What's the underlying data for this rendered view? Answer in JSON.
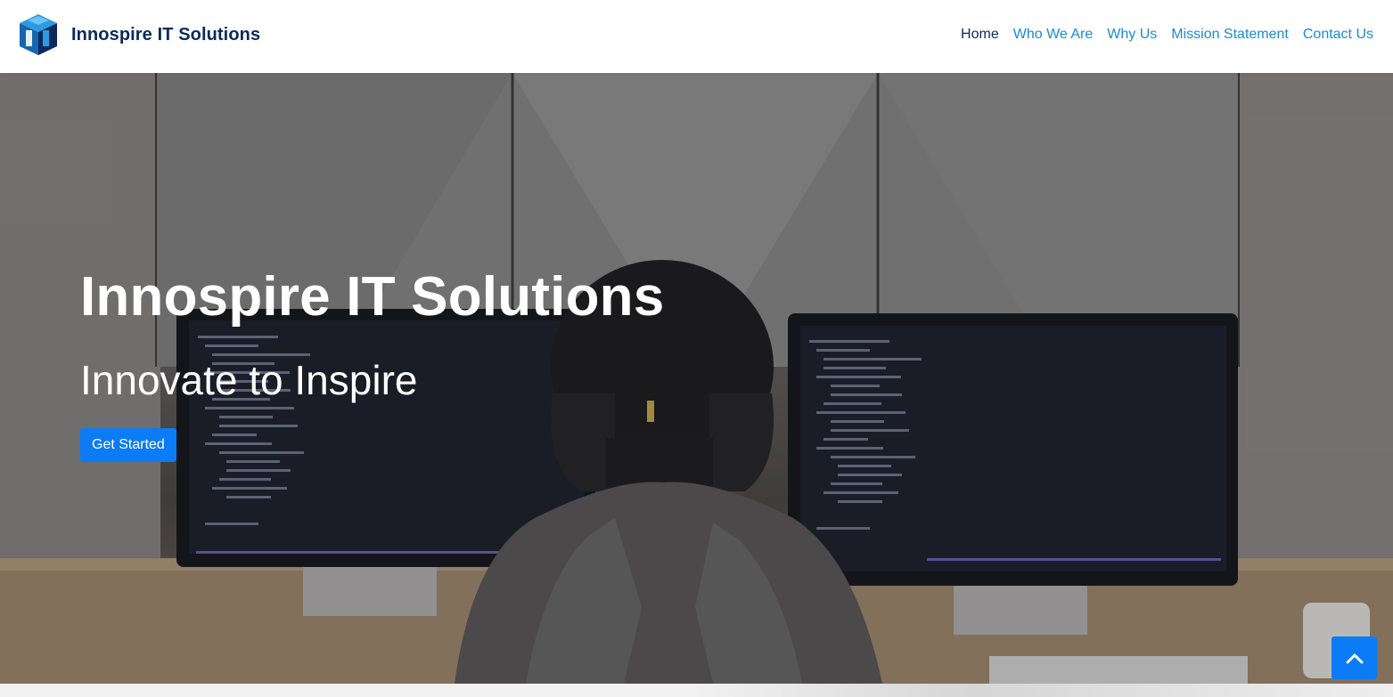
{
  "brand": {
    "name": "Innospire IT Solutions",
    "logo_icon": "cube-logo-icon"
  },
  "nav": {
    "items": [
      {
        "label": "Home",
        "active": true
      },
      {
        "label": "Who We Are",
        "active": false
      },
      {
        "label": "Why Us",
        "active": false
      },
      {
        "label": "Mission Statement",
        "active": false
      },
      {
        "label": "Contact Us",
        "active": false
      }
    ]
  },
  "hero": {
    "title": "Innospire IT Solutions",
    "tagline": "Innovate to Inspire",
    "cta_label": "Get Started",
    "background_icon": "developer-workspace-photo"
  },
  "scroll_top": {
    "icon": "chevron-up-icon"
  },
  "colors": {
    "brand_dark": "#0b2a5b",
    "nav_link": "#1a8bd0",
    "accent": "#0b7cf5"
  }
}
